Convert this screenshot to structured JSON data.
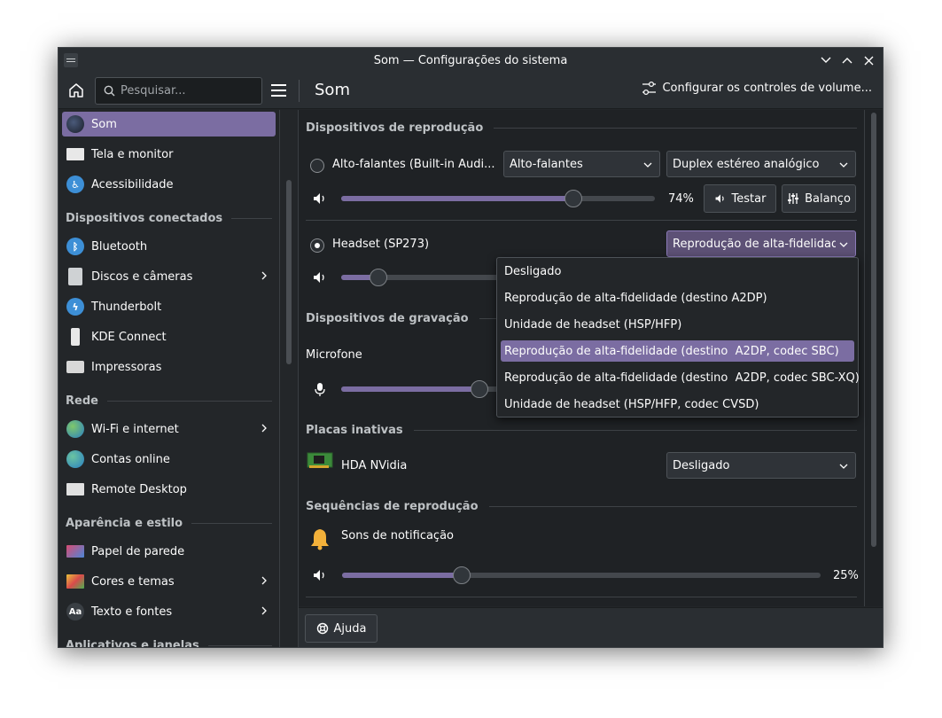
{
  "window": {
    "title": "Som — Configurações do sistema"
  },
  "toolbar": {
    "search_placeholder": "Pesquisar...",
    "page_title": "Som",
    "config_button": "Configurar os controles de volume..."
  },
  "sidebar": {
    "items": [
      {
        "label": "Som",
        "icon": "speaker-icon",
        "selected": true
      },
      {
        "label": "Tela e monitor",
        "icon": "monitor-icon"
      },
      {
        "label": "Acessibilidade",
        "icon": "accessibility-icon"
      }
    ],
    "sections": [
      {
        "header": "Dispositivos conectados",
        "items": [
          {
            "label": "Bluetooth",
            "icon": "bluetooth-icon"
          },
          {
            "label": "Discos e câmeras",
            "icon": "disk-icon",
            "has_submenu": true
          },
          {
            "label": "Thunderbolt",
            "icon": "thunderbolt-icon"
          },
          {
            "label": "KDE Connect",
            "icon": "phone-icon"
          },
          {
            "label": "Impressoras",
            "icon": "printer-icon"
          }
        ]
      },
      {
        "header": "Rede",
        "items": [
          {
            "label": "Wi-Fi e internet",
            "icon": "globe-icon",
            "has_submenu": true
          },
          {
            "label": "Contas online",
            "icon": "accounts-icon"
          },
          {
            "label": "Remote Desktop",
            "icon": "remote-desktop-icon"
          }
        ]
      },
      {
        "header": "Aparência e estilo",
        "items": [
          {
            "label": "Papel de parede",
            "icon": "wallpaper-icon"
          },
          {
            "label": "Cores e temas",
            "icon": "colors-icon",
            "has_submenu": true
          },
          {
            "label": "Texto e fontes",
            "icon": "fonts-icon",
            "icon_text": "Aa",
            "has_submenu": true
          }
        ]
      },
      {
        "header": "Aplicativos e janelas",
        "items": []
      }
    ]
  },
  "main": {
    "playback": {
      "header": "Dispositivos de reprodução",
      "device1": {
        "name": "Alto-falantes (Built-in Audi...",
        "port": "Alto-falantes",
        "profile": "Duplex estéreo analógico",
        "volume": 74,
        "volume_label": "74%",
        "test_button": "Testar",
        "balance_button": "Balanço",
        "default": false
      },
      "device2": {
        "name": "Headset (SP273)",
        "profile": "Reprodução de alta-fidelidade (",
        "volume": 8,
        "default": true
      }
    },
    "recording": {
      "header": "Dispositivos de gravação",
      "mic_label": "Microfone",
      "volume": 30
    },
    "inactive": {
      "header": "Placas inativas",
      "card_name": "HDA NVidia",
      "card_profile": "Desligado"
    },
    "streams": {
      "header": "Sequências de reprodução",
      "stream_name": "Sons de notificação",
      "volume": 25,
      "volume_label": "25%"
    },
    "profile_dropdown": {
      "options": [
        "Desligado",
        "Reprodução de alta-fidelidade (destino A2DP)",
        "Unidade de headset (HSP/HFP)",
        "Reprodução de alta-fidelidade (destino  A2DP, codec SBC)",
        "Reprodução de alta-fidelidade (destino  A2DP, codec SBC-XQ)",
        "Unidade de headset (HSP/HFP, codec CVSD)"
      ],
      "selected_index": 3
    }
  },
  "footer": {
    "help_button": "Ajuda"
  },
  "colors": {
    "accent": "#7b6da2",
    "background": "#232629",
    "text": "#fcfcfc"
  }
}
